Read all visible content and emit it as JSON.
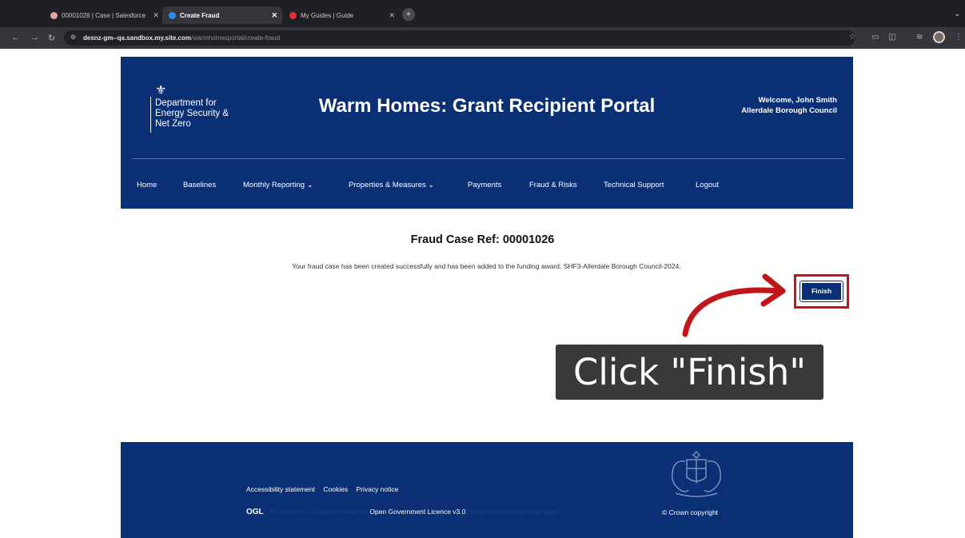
{
  "browser": {
    "tabs": [
      {
        "title": "00001026 | Case | Salesforce",
        "favicon_color": "#e8a0a0"
      },
      {
        "title": "Create Fraud",
        "favicon_color": "#2d8cf0"
      },
      {
        "title": "My Guides | Guide",
        "favicon_color": "#e0322c"
      }
    ],
    "url_host": "desnz-gm--qa.sandbox.my.site.com",
    "url_path": "/warmhomesportal/create-fraud"
  },
  "header": {
    "department": "Department for Energy Security & Net Zero",
    "portal_title": "Warm Homes: Grant Recipient Portal",
    "welcome_line": "Welcome, John Smith",
    "organisation": "Allerdale Borough Council"
  },
  "nav": {
    "items": [
      "Home",
      "Baselines",
      "Monthly Reporting ⌄",
      "Properties & Measures ⌄",
      "Payments",
      "Fraud & Risks",
      "Technical Support",
      "Logout"
    ]
  },
  "content": {
    "case_title": "Fraud Case Ref: 00001026",
    "success_message": "Your fraud case has been created successfully and has been added to the funding award: SHF3-Allerdale Borough Council-2024.",
    "finish_label": "Finish",
    "callout": "Click \"Finish\""
  },
  "footer": {
    "links": [
      "Accessibility statement",
      "Cookies",
      "Privacy notice"
    ],
    "ogl": "OGL",
    "licence_prefix": "All content is available under the",
    "licence_link": "Open Government Licence v3.0",
    "licence_suffix": ", except where otherwise stated",
    "copyright": "© Crown copyright"
  },
  "colors": {
    "brand_navy": "#0b2f74",
    "highlight_red": "#c1161c"
  }
}
